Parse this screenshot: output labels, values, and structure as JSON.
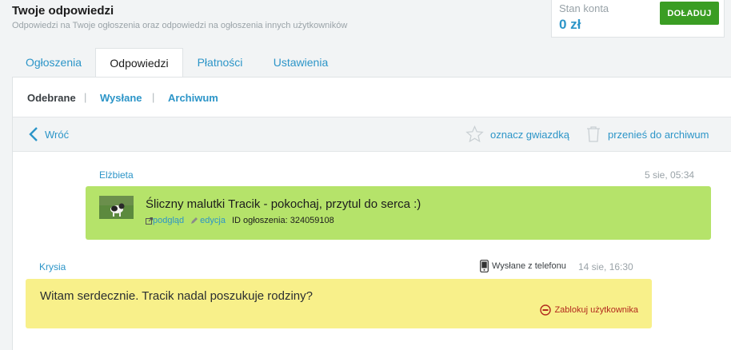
{
  "header": {
    "title": "Twoje odpowiedzi",
    "subtitle": "Odpowiedzi na Twoje ogłoszenia oraz odpowiedzi na ogłoszenia innych użytkowników"
  },
  "balance": {
    "label": "Stan konta",
    "value": "0 zł",
    "topup_label": "DOŁADUJ"
  },
  "tabs": [
    {
      "label": "Ogłoszenia",
      "active": false
    },
    {
      "label": "Odpowiedzi",
      "active": true
    },
    {
      "label": "Płatności",
      "active": false
    },
    {
      "label": "Ustawienia",
      "active": false
    }
  ],
  "subtabs": [
    {
      "label": "Odebrane",
      "active": true
    },
    {
      "label": "Wysłane",
      "active": false
    },
    {
      "label": "Archiwum",
      "active": false
    }
  ],
  "subtab_separator": "|",
  "toolbar": {
    "back_label": "Wróć",
    "star_label": "oznacz gwiazdką",
    "archive_label": "przenieś do archiwum"
  },
  "messages": [
    {
      "sender": "Elżbieta",
      "time": "5 sie, 05:34",
      "ad_title": "Śliczny malutki Tracik - pokochaj, przytul do serca :)",
      "preview_label": "podgląd",
      "edit_label": "edycja",
      "ad_id": "ID ogłoszenia: 324059108",
      "color": "#b5e36a"
    },
    {
      "sender": "Krysia",
      "sent_from": "Wysłane z telefonu",
      "time": "14 sie, 16:30",
      "text": "Witam serdecznie. Tracik nadal poszukuje rodziny?",
      "block_label": "Zablokuj użytkownika",
      "color": "#f8f08a"
    }
  ],
  "colors": {
    "accent": "#2c95c8",
    "topup_button": "#3a9d23",
    "block_red": "#b22a1e"
  }
}
